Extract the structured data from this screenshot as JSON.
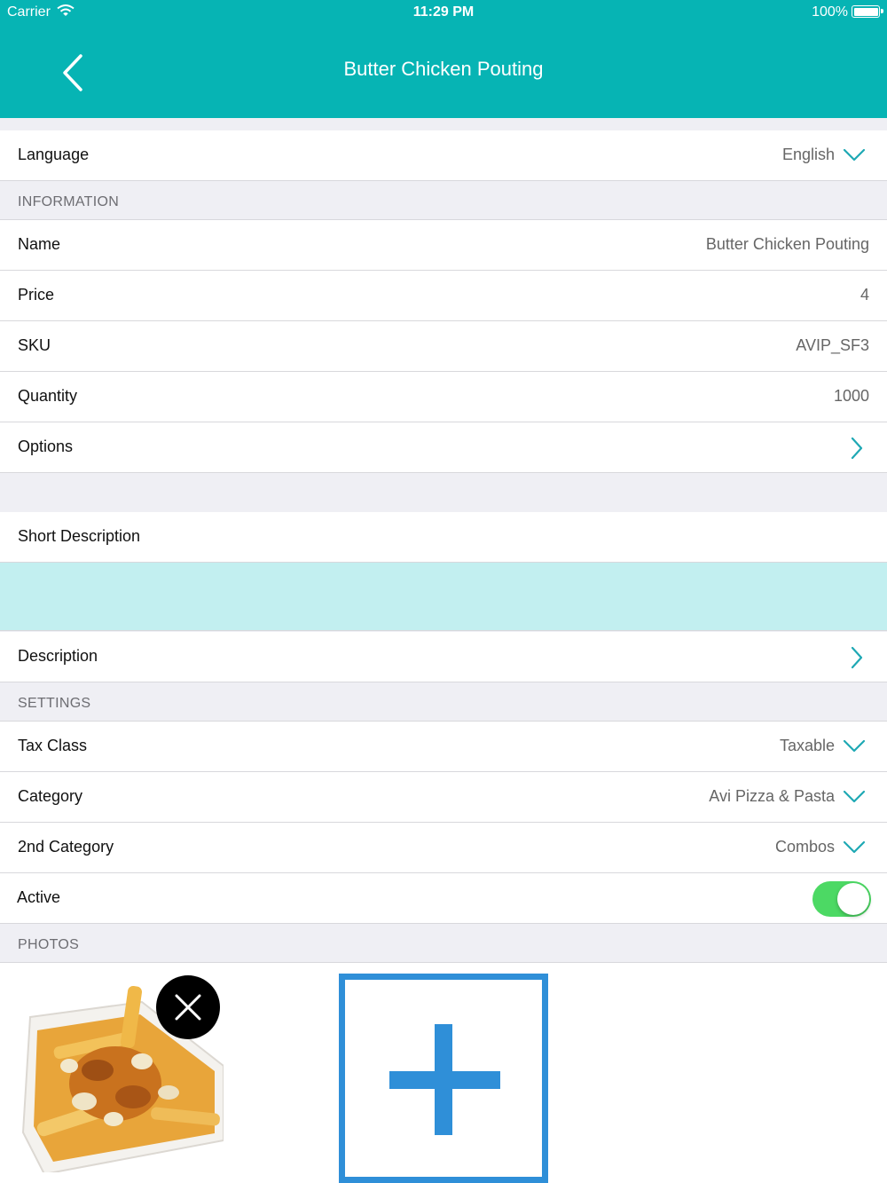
{
  "status_bar": {
    "carrier": "Carrier",
    "time": "11:29 PM",
    "battery": "100%"
  },
  "nav": {
    "title": "Butter Chicken Pouting"
  },
  "language": {
    "label": "Language",
    "value": "English"
  },
  "information": {
    "header": "INFORMATION",
    "name": {
      "label": "Name",
      "value": "Butter Chicken Pouting"
    },
    "price": {
      "label": "Price",
      "value": "4"
    },
    "sku": {
      "label": "SKU",
      "value": "AVIP_SF3"
    },
    "quantity": {
      "label": "Quantity",
      "value": "1000"
    },
    "options": {
      "label": "Options"
    }
  },
  "short_description": {
    "label": "Short Description",
    "value": ""
  },
  "description": {
    "label": "Description"
  },
  "settings": {
    "header": "SETTINGS",
    "tax_class": {
      "label": "Tax Class",
      "value": "Taxable"
    },
    "category": {
      "label": "Category",
      "value": "Avi Pizza & Pasta"
    },
    "second_category": {
      "label": "2nd Category",
      "value": "Combos"
    },
    "active": {
      "label": "Active",
      "on": true
    }
  },
  "photos": {
    "header": "PHOTOS"
  },
  "colors": {
    "accent": "#06b4b4",
    "chevron": "#1ea8b4",
    "toggle_on": "#4cd964",
    "description_highlight": "#c2eff0",
    "add_photo_blue": "#2f8fd8"
  }
}
